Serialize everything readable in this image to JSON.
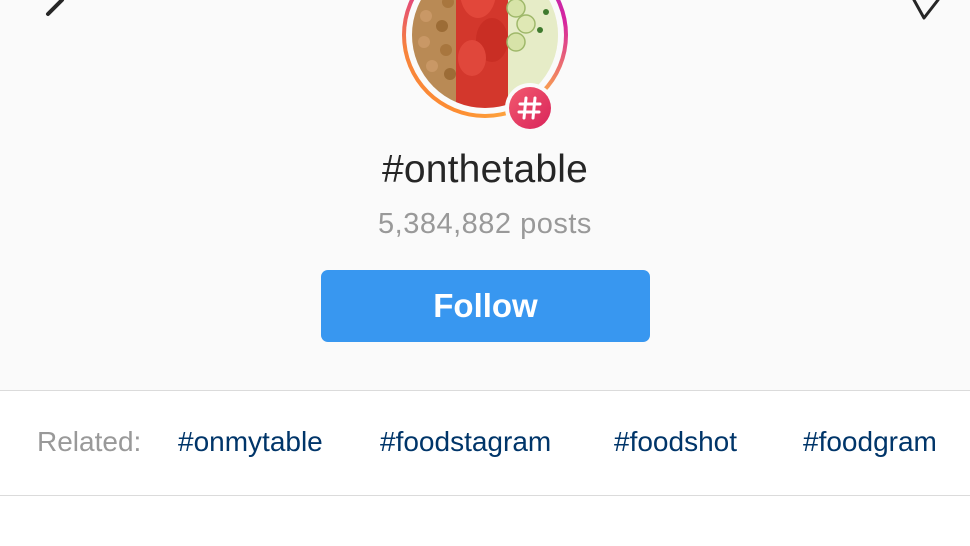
{
  "hashtag": {
    "title": "#onthetable",
    "post_count": "5,384,882 posts"
  },
  "follow_button": {
    "label": "Follow"
  },
  "related": {
    "label": "Related:",
    "tags": [
      "#onmytable",
      "#foodstagram",
      "#foodshot",
      "#foodgram"
    ]
  },
  "icons": {
    "back": "back-arrow-icon",
    "send": "direct-send-icon",
    "badge": "hashtag-badge-icon"
  },
  "colors": {
    "follow_button": "#3897f0",
    "tag_link": "#003569",
    "muted_text": "#999999",
    "title_text": "#262626",
    "badge": "#e1306c"
  }
}
